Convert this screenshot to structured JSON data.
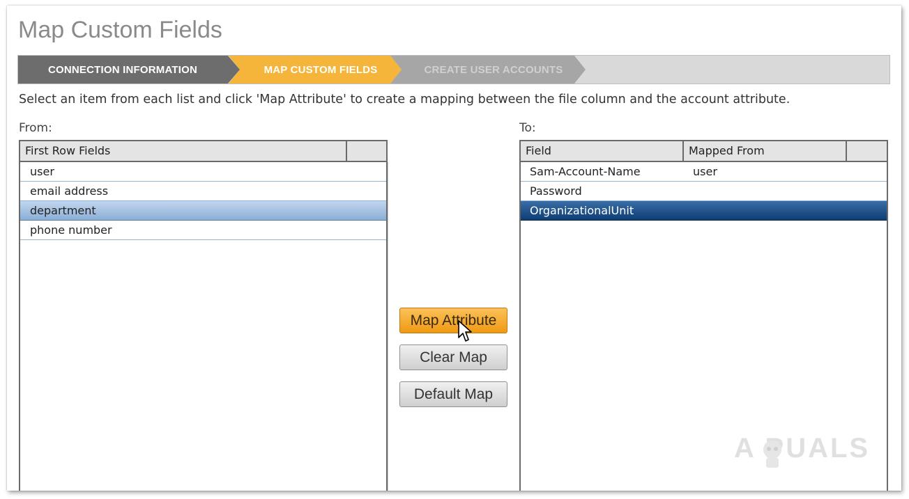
{
  "page": {
    "title": "Map Custom Fields"
  },
  "wizard": {
    "steps": [
      {
        "label": "CONNECTION INFORMATION",
        "state": "completed"
      },
      {
        "label": "MAP CUSTOM FIELDS",
        "state": "active"
      },
      {
        "label": "CREATE USER ACCOUNTS",
        "state": "pending"
      }
    ]
  },
  "instructions": "Select an item from each list and click 'Map Attribute' to create a mapping between the file column and the account attribute.",
  "from": {
    "label": "From:",
    "columns": [
      "First Row Fields",
      ""
    ],
    "rows": [
      {
        "value": "user",
        "selected": false
      },
      {
        "value": "email address",
        "selected": false
      },
      {
        "value": "department",
        "selected": true
      },
      {
        "value": "phone number",
        "selected": false
      }
    ]
  },
  "to": {
    "label": "To:",
    "columns": [
      "Field",
      "Mapped From",
      ""
    ],
    "rows": [
      {
        "field": "Sam-Account-Name",
        "mapped_from": "user",
        "selected": false
      },
      {
        "field": "Password",
        "mapped_from": "",
        "selected": false
      },
      {
        "field": "OrganizationalUnit",
        "mapped_from": "",
        "selected": true
      }
    ]
  },
  "buttons": {
    "map_attribute": "Map Attribute",
    "clear_map": "Clear Map",
    "default_map": "Default Map"
  },
  "watermark": {
    "text": "A PUALS"
  },
  "colors": {
    "active_step": "#f5b53a",
    "completed_step": "#6d6d6d",
    "pending_step": "#a6a6a6",
    "selected_row_light": "#a9c3e3",
    "selected_row_dark": "#1a4c84",
    "primary_button": "#f5a623"
  }
}
